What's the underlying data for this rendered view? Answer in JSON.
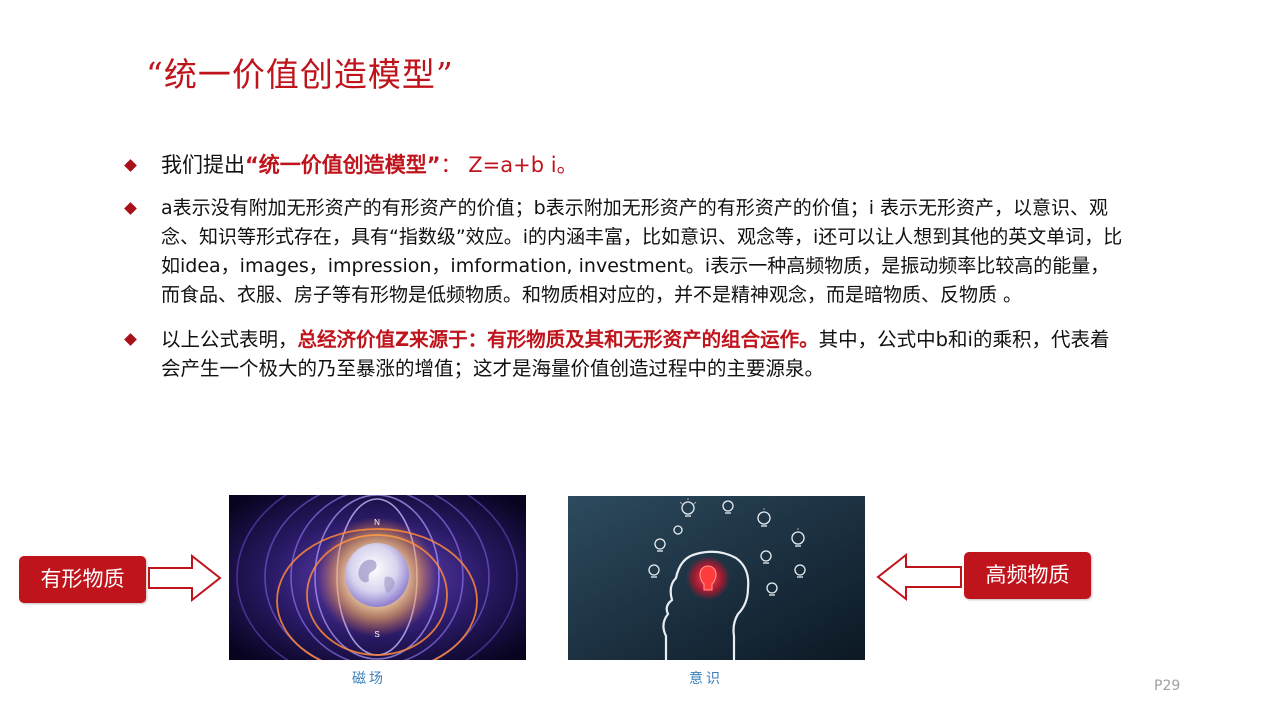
{
  "slide": {
    "title": "“统一价值创造模型”",
    "page_number": "P29"
  },
  "bullets": {
    "b1": {
      "prefix": "我们提出",
      "highlight": "“统一价值创造模型”",
      "formula": "： Z=a+b i。"
    },
    "b2": {
      "text": "a表示没有附加无形资产的有形资产的价值；b表示附加无形资产的有形资产的价值；i 表示无形资产，以意识、观念、知识等形式存在，具有“指数级”效应。i的内涵丰富，比如意识、观念等，i还可以让人想到其他的英文单词，比如idea，images，impression，imformation, investment。i表示一种高频物质，是振动频率比较高的能量，而食品、衣服、房子等有形物是低频物质。和物质相对应的，并不是精神观念，而是暗物质、反物质 。"
    },
    "b3": {
      "prefix": "以上公式表明，",
      "highlight": "总经济价值Z来源于：有形物质及其和无形资产的组合运作。",
      "suffix": "其中，公式中b和i的乘积，代表着会产生一个极大的乃至暴涨的增值；这才是海量价值创造过程中的主要源泉。"
    }
  },
  "callouts": {
    "left": "有形物质",
    "right": "高频物质"
  },
  "figures": {
    "magnet": {
      "caption": "磁场",
      "pole_north": "N",
      "pole_south": "S"
    },
    "mind": {
      "caption": "意识"
    }
  },
  "colors": {
    "accent_red": "#c0141c",
    "caption_blue": "#3a7fb8",
    "page_num_gray": "#a0a0a0"
  },
  "icons": {
    "bullet": "diamond-bullet",
    "arrow_right": "hollow-right-arrow",
    "arrow_left": "hollow-left-arrow"
  }
}
